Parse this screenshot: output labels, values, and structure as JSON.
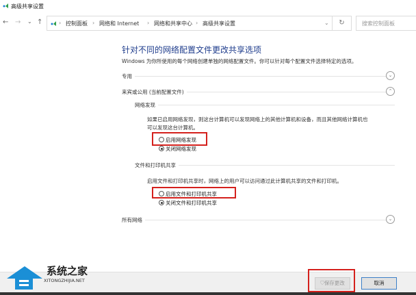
{
  "window": {
    "title": "高级共享设置"
  },
  "nav": {
    "back": "←",
    "forward": "→",
    "recent": "⌄",
    "up": "↑",
    "breadcrumbs": [
      "控制面板",
      "网络和 Internet",
      "网络和共享中心",
      "高级共享设置"
    ],
    "dropdown": "⌄",
    "refresh": "↻",
    "search_placeholder": "搜索控制面板"
  },
  "main": {
    "heading": "针对不同的网络配置文件更改共享选项",
    "description": "Windows 为你所使用的每个网络创建单独的网络配置文件。你可以针对每个配置文件选择特定的选项。",
    "profiles": {
      "private": {
        "label": "专用",
        "chevron": "⌄"
      },
      "guest": {
        "label": "来宾或公用 (当前配置文件)",
        "chevron": "⌃",
        "discovery": {
          "title": "网络发现",
          "desc1": "如果已启用网络发现，则这台计算机可以发现网络上的其他计算机和设备，而且其他网络计算机也",
          "desc2": "可以发现这台计算机。",
          "on": "启用网络发现",
          "off": "关闭网络发现",
          "selected": "off"
        },
        "sharing": {
          "title": "文件和打印机共享",
          "desc": "启用文件和打印机共享时，网络上的用户可以访问通过此计算机共享的文件和打印机。",
          "on": "启用文件和打印机共享",
          "off": "关闭文件和打印机共享",
          "selected": "off"
        }
      },
      "all": {
        "label": "所有网络",
        "chevron": "⌄"
      }
    }
  },
  "footer": {
    "save": "保存更改",
    "cancel": "取消"
  },
  "watermark": {
    "name": "系统之家",
    "url": "XITONGZHIJIA.NET"
  },
  "colors": {
    "heading": "#1e3c8c",
    "highlight": "#d4201c"
  }
}
